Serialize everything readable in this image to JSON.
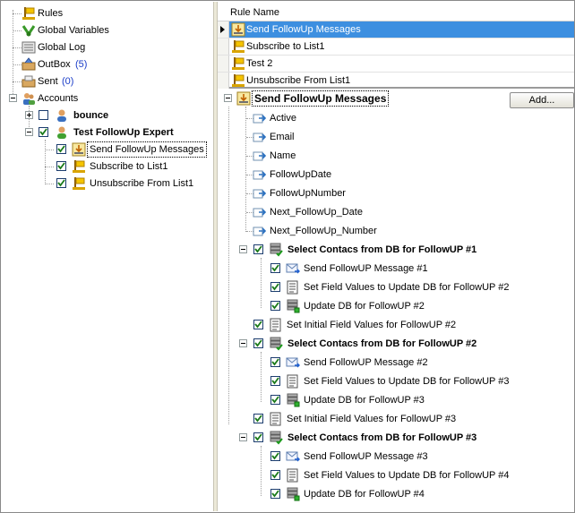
{
  "left_tree": {
    "rules": "Rules",
    "global_variables": "Global Variables",
    "global_log": "Global Log",
    "outbox": "OutBox",
    "outbox_count": "(5)",
    "sent": "Sent",
    "sent_count": "(0)",
    "accounts": "Accounts",
    "bounce": "bounce",
    "test_followup_expert": "Test FollowUp Expert",
    "rule_send_followup": "Send FollowUp Messages",
    "rule_subscribe": "Subscribe to List1",
    "rule_unsubscribe": "Unsubscribe From List1"
  },
  "rules_grid": {
    "header": "Rule Name",
    "rows": [
      "Send FollowUp Messages",
      "Subscribe to List1",
      "Test 2",
      "Unsubscribe From List1"
    ]
  },
  "rule_tree": {
    "root": "Send FollowUp Messages",
    "add_button": "Add...",
    "fields": [
      "Active",
      "Email",
      "Name",
      "FollowUpDate",
      "FollowUpNumber",
      "Next_FollowUp_Date",
      "Next_FollowUp_Number"
    ],
    "select1": "Select Contacs from DB for FollowUP #1",
    "send1": "Send FollowUP Message #1",
    "setfields1": "Set Field Values to Update DB for FollowUP #2",
    "update1": "Update DB for FollowUP #2",
    "init1": "Set Initial Field Values for FollowUP #2",
    "select2": "Select Contacs from DB for FollowUP #2",
    "send2": "Send FollowUP Message #2",
    "setfields2": "Set Field Values to Update DB for FollowUP #3",
    "update2": "Update DB for FollowUP #3",
    "init2": "Set Initial Field Values for FollowUP #3",
    "select3": "Select Contacs from DB for FollowUP #3",
    "send3": "Send FollowUP Message #3",
    "setfields3": "Set Field Values to Update DB for FollowUP #4",
    "update3": "Update DB for FollowUP #4"
  },
  "colors": {
    "selection": "#3d8fe0",
    "count_blue": "#1a3cc8",
    "check_border": "#1c3d6e"
  }
}
